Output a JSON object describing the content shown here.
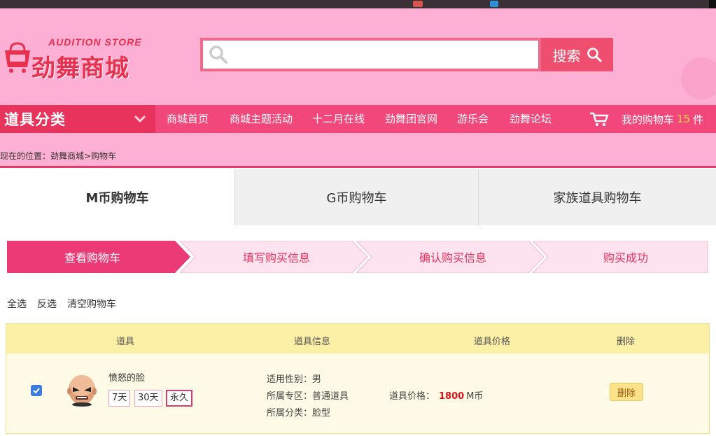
{
  "logo": {
    "en": "AUDITION STORE",
    "cn": "劲舞商城"
  },
  "search": {
    "placeholder": "",
    "value": "",
    "button_label": "搜索"
  },
  "nav": {
    "category_label": "道具分类",
    "items": [
      "商城首页",
      "商城主题活动",
      "十二月在线",
      "劲舞团官网",
      "游乐会",
      "劲舞论坛"
    ],
    "cart": {
      "prefix": "我的购物车",
      "count": "15",
      "suffix": "件"
    }
  },
  "breadcrumb": "现在的位置：劲舞商城>购物车",
  "tabs": [
    "M币购物车",
    "G币购物车",
    "家族道具购物车"
  ],
  "steps": [
    "查看购物车",
    "填写购买信息",
    "确认购买信息",
    "购买成功"
  ],
  "selection": [
    "全选",
    "反选",
    "清空购物车"
  ],
  "table": {
    "headers": [
      "道具",
      "道具信息",
      "道具价格",
      "删除"
    ],
    "rows": [
      {
        "checked": true,
        "name": "愤怒的脸",
        "durations": [
          "7天",
          "30天",
          "永久"
        ],
        "selected_duration": "永久",
        "info": [
          "适用性别：男",
          "所属专区：普通道具",
          "所属分类：脸型"
        ],
        "price_label": "道具价格：",
        "price": "1800",
        "currency": "M币",
        "delete_label": "删除"
      }
    ]
  },
  "colors": {
    "header_pink": "#fdafd4",
    "nav_pink": "#f1477a",
    "accent_red": "#e8304f",
    "step_active": "#ec3a76",
    "price_red": "#d6141e"
  }
}
